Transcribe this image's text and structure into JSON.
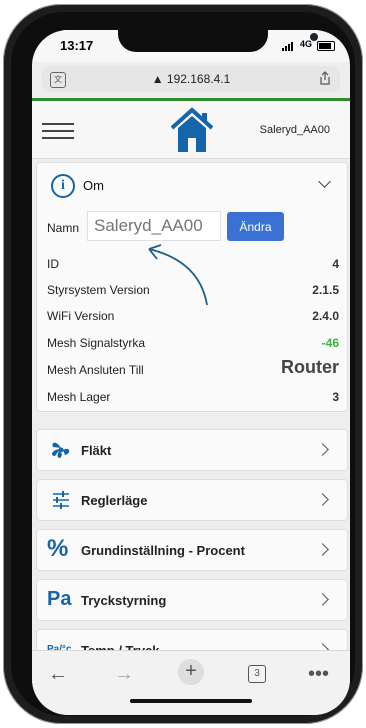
{
  "status": {
    "time": "13:17",
    "network": "4G"
  },
  "browser": {
    "url": "▲ 192.168.4.1"
  },
  "header": {
    "device_name": "Saleryd_AA00"
  },
  "om": {
    "title": "Om",
    "name_label": "Namn",
    "name_placeholder": "Saleryd_AA00",
    "change_button": "Ändra",
    "rows": [
      {
        "label": "ID",
        "value": "4"
      },
      {
        "label": "Styrsystem Version",
        "value": "2.1.5"
      },
      {
        "label": "WiFi Version",
        "value": "2.4.0"
      },
      {
        "label": "Mesh Signalstyrka",
        "value": "-46"
      },
      {
        "label": "Mesh Ansluten Till",
        "value": "Router"
      },
      {
        "label": "Mesh Lager",
        "value": "3"
      }
    ]
  },
  "menu": [
    {
      "label": "Fläkt",
      "icon": "fan-icon"
    },
    {
      "label": "Reglerläge",
      "icon": "sliders-icon"
    },
    {
      "label": "Grundinställning - Procent",
      "icon": "percent-icon",
      "icon_text": "%"
    },
    {
      "label": "Tryckstyrning",
      "icon": "pascal-icon",
      "icon_text": "Pa"
    },
    {
      "label": "Temp / Tryck",
      "icon": "temp-pressure-icon",
      "icon_text": "Pa/°c"
    }
  ],
  "toolbar": {
    "tabs_count": "3"
  },
  "colors": {
    "accent": "#3a72d4",
    "brand_blue": "#1565a8",
    "green_bar": "#2e8b2e",
    "signal_green": "#3cb43c"
  }
}
